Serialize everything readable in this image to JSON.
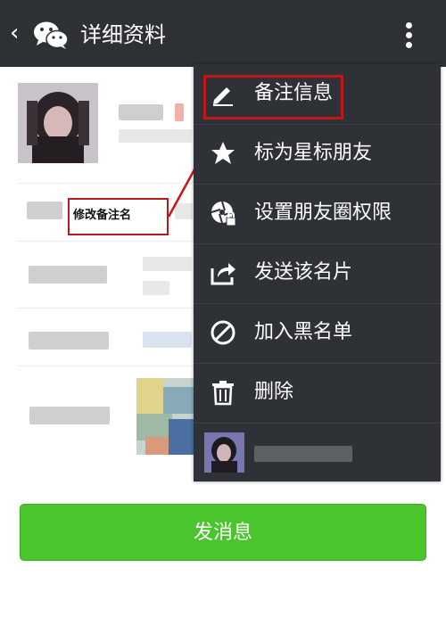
{
  "topbar": {
    "back_icon": "chevron-left-icon",
    "logo_icon": "wechat-logo-icon",
    "title": "详细资料",
    "more_icon": "more-vertical-icon"
  },
  "annotation": {
    "text": "修改备注名",
    "color": "#c2171a"
  },
  "menu": {
    "items": [
      {
        "icon": "pencil-icon",
        "label": "备注信息"
      },
      {
        "icon": "star-icon",
        "label": "标为星标朋友"
      },
      {
        "icon": "aperture-lock-icon",
        "label": "设置朋友圈权限"
      },
      {
        "icon": "share-icon",
        "label": "发送该名片"
      },
      {
        "icon": "block-icon",
        "label": "加入黑名单"
      },
      {
        "icon": "trash-icon",
        "label": "删除"
      }
    ]
  },
  "send_button": {
    "label": "发消息",
    "color": "#4bc52e"
  }
}
